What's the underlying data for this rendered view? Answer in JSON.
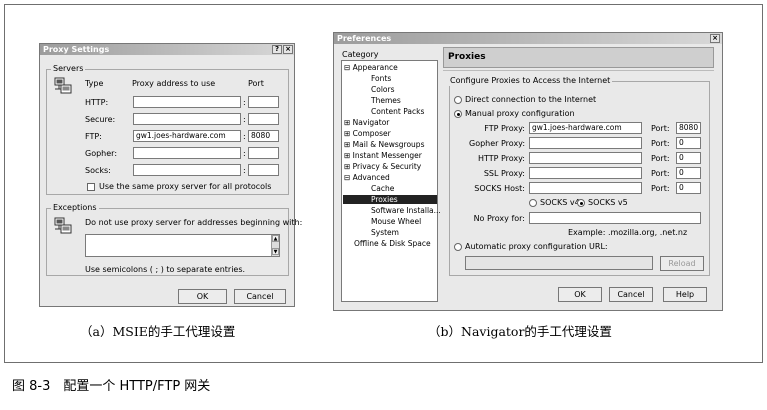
{
  "proxy_settings": {
    "title": "Proxy Settings",
    "help_btn": "?",
    "close_btn": "×",
    "servers_group": "Servers",
    "col_type": "Type",
    "col_address": "Proxy address to use",
    "col_port": "Port",
    "rows": [
      {
        "label": "HTTP:",
        "address": "",
        "port": ""
      },
      {
        "label": "Secure:",
        "address": "",
        "port": ""
      },
      {
        "label": "FTP:",
        "address": "gw1.joes-hardware.com",
        "port": "8080"
      },
      {
        "label": "Gopher:",
        "address": "",
        "port": ""
      },
      {
        "label": "Socks:",
        "address": "",
        "port": ""
      }
    ],
    "colon": ":",
    "same_proxy_label": "Use the same proxy server for all protocols",
    "exceptions_group": "Exceptions",
    "exceptions_label": "Do not use proxy server for addresses beginning with:",
    "exceptions_value": "",
    "semicolon_note": "Use semicolons ( ; ) to separate entries.",
    "ok": "OK",
    "cancel": "Cancel"
  },
  "preferences": {
    "title": "Preferences",
    "close_btn": "×",
    "category_label": "Category",
    "tree": [
      {
        "text": "⊟ Appearance"
      },
      {
        "text": "Fonts"
      },
      {
        "text": "Colors"
      },
      {
        "text": "Themes"
      },
      {
        "text": "Content Packs"
      },
      {
        "text": "⊞ Navigator"
      },
      {
        "text": "⊞ Composer"
      },
      {
        "text": "⊞ Mail & Newsgroups"
      },
      {
        "text": "⊞ Instant Messenger"
      },
      {
        "text": "⊞ Privacy & Security"
      },
      {
        "text": "⊟ Advanced"
      },
      {
        "text": "Cache"
      },
      {
        "text": "Proxies"
      },
      {
        "text": "Software Installa..."
      },
      {
        "text": "Mouse Wheel"
      },
      {
        "text": "System"
      },
      {
        "text": "Offline & Disk Space"
      }
    ],
    "pane_title": "Proxies",
    "configure_group": "Configure Proxies to Access the Internet",
    "direct_label": "Direct connection to the Internet",
    "manual_label": "Manual proxy configuration",
    "fields": [
      {
        "label": "FTP Proxy:",
        "value": "gw1.joes-hardware.com",
        "port_label": "Port:",
        "port": "8080"
      },
      {
        "label": "Gopher Proxy:",
        "value": "",
        "port_label": "Port:",
        "port": "0"
      },
      {
        "label": "HTTP Proxy:",
        "value": "",
        "port_label": "Port:",
        "port": "0"
      },
      {
        "label": "SSL Proxy:",
        "value": "",
        "port_label": "Port:",
        "port": "0"
      },
      {
        "label": "SOCKS Host:",
        "value": "",
        "port_label": "Port:",
        "port": "0"
      }
    ],
    "socks_v4": "SOCKS v4",
    "socks_v5": "SOCKS v5",
    "no_proxy_label": "No Proxy for:",
    "no_proxy_value": "",
    "example": "Example: .mozilla.org, .net.nz",
    "auto_label": "Automatic proxy configuration URL:",
    "auto_value": "",
    "reload": "Reload",
    "ok": "OK",
    "cancel": "Cancel",
    "help": "Help"
  },
  "captions": {
    "a": "（a）MSIE的手工代理设置",
    "b": "（b）Navigator的手工代理设置"
  },
  "figure_caption": "图 8-3　配置一个 HTTP/FTP 网关"
}
